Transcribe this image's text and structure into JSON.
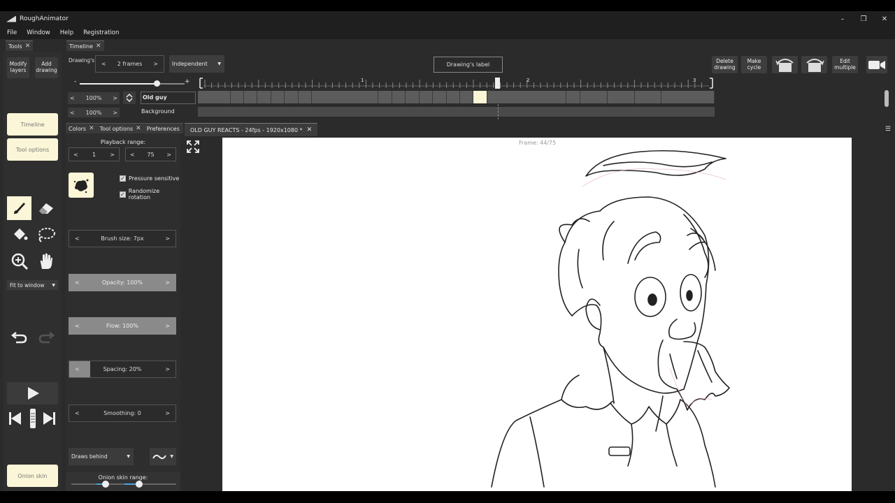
{
  "app": {
    "title": "RoughAnimator"
  },
  "window_buttons": {
    "minimize": "–",
    "maximize": "❐",
    "close": "✕"
  },
  "menu": [
    "File",
    "Window",
    "Help",
    "Registration"
  ],
  "panels": {
    "tools_tab": "Tools",
    "timeline_tab": "Timeline"
  },
  "left": {
    "modify_layers": "Modify layers",
    "add_drawing": "Add drawing",
    "timeline_btn": "Timeline",
    "tool_options_btn": "Tool options",
    "zoom_select": "Fit to window",
    "onion_skin_btn": "Onion skin"
  },
  "timeline": {
    "duration_label": "Drawing's duration:",
    "duration_value": "2 frames",
    "mode": "Independent",
    "drawing_label_btn": "Drawing's label",
    "delete_drawing": "Delete drawing",
    "make_cycle": "Make cycle",
    "edit_multiple": "Edit multiple",
    "zoom_minus": "-",
    "zoom_plus": "+",
    "ruler_marks": [
      "1",
      "2",
      "3"
    ],
    "layers": [
      {
        "opacity": "100%",
        "name": "Old guy"
      },
      {
        "opacity": "100%",
        "name": "Background"
      }
    ]
  },
  "tool_panel": {
    "tabs": [
      "Colors",
      "Tool options",
      "Preferences"
    ],
    "playback_range_label": "Playback range:",
    "playback_start": "1",
    "playback_end": "75",
    "pressure_sensitive": "Pressure sensitive",
    "randomize_rotation": "Randomize rotation",
    "brush_size": "Brush size: 7px",
    "opacity": "Opacity: 100%",
    "flow": "Flow: 100%",
    "spacing": "Spacing: 20%",
    "smoothing": "Smoothing: 0",
    "blend_mode": "Draws behind",
    "onion_range_label": "Onion skin range:"
  },
  "document": {
    "tab_title": "OLD GUY REACTS - 24fps - 1920x1080 *",
    "frame_label": "Frame: 44/75"
  },
  "colors": {
    "accent_yellow": "#fbf6d7",
    "panel": "#2b2b2b"
  }
}
